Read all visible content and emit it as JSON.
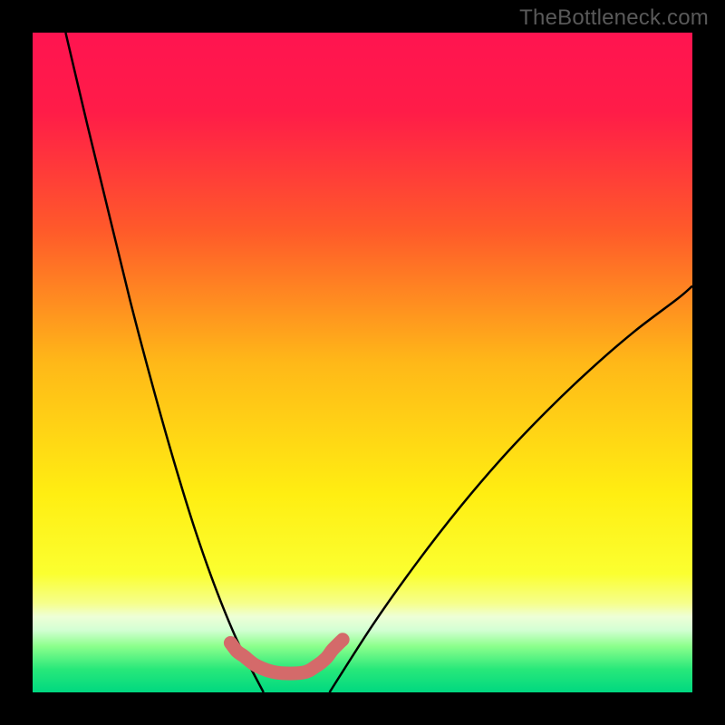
{
  "watermark": "TheBottleneck.com",
  "chart_data": {
    "type": "line",
    "title": "",
    "xlabel": "",
    "ylabel": "",
    "xlim": [
      0,
      1
    ],
    "ylim": [
      0,
      1
    ],
    "series": [
      {
        "name": "left-curve",
        "x": [
          0.05,
          0.083,
          0.116,
          0.148,
          0.181,
          0.214,
          0.247,
          0.28,
          0.313,
          0.35
        ],
        "values": [
          1.0,
          0.86,
          0.724,
          0.593,
          0.468,
          0.351,
          0.244,
          0.151,
          0.072,
          0.0
        ]
      },
      {
        "name": "right-curve",
        "x": [
          0.45,
          0.516,
          0.582,
          0.648,
          0.714,
          0.78,
          0.846,
          0.912,
          0.978,
          1.0
        ],
        "values": [
          0.0,
          0.103,
          0.196,
          0.281,
          0.358,
          0.427,
          0.49,
          0.547,
          0.597,
          0.616
        ]
      },
      {
        "name": "plateau-segment",
        "x": [
          0.3,
          0.31,
          0.32,
          0.34,
          0.37,
          0.41,
          0.43,
          0.445,
          0.455,
          0.47
        ],
        "values": [
          0.075,
          0.062,
          0.055,
          0.04,
          0.03,
          0.03,
          0.04,
          0.052,
          0.065,
          0.08
        ]
      }
    ],
    "gradient_stops": [
      {
        "offset": 0.0,
        "color": "#ff1450"
      },
      {
        "offset": 0.12,
        "color": "#ff1c48"
      },
      {
        "offset": 0.3,
        "color": "#ff5a2a"
      },
      {
        "offset": 0.5,
        "color": "#ffb818"
      },
      {
        "offset": 0.7,
        "color": "#ffee12"
      },
      {
        "offset": 0.82,
        "color": "#fbff30"
      },
      {
        "offset": 0.865,
        "color": "#f6ff8c"
      },
      {
        "offset": 0.885,
        "color": "#eeffd6"
      },
      {
        "offset": 0.905,
        "color": "#d4ffd4"
      },
      {
        "offset": 0.93,
        "color": "#8cff8c"
      },
      {
        "offset": 0.965,
        "color": "#28e87a"
      },
      {
        "offset": 1.0,
        "color": "#00d880"
      }
    ],
    "marker_color": "#d46a6a",
    "marker_radius_px": 7,
    "plateau_stroke_width_px": 15,
    "curve_stroke_width_px": 2.5
  }
}
